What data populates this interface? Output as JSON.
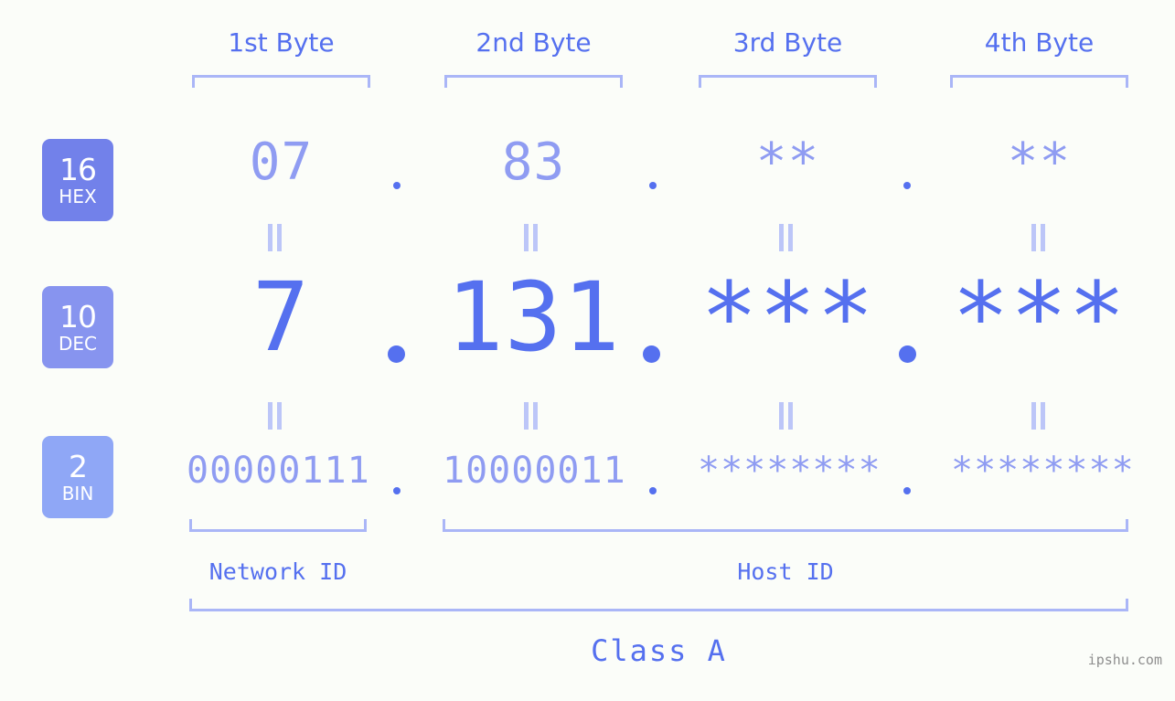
{
  "background_color": "#fbfdf9",
  "accent_color": "#5570ef",
  "muted_accent_color": "#8f9cf2",
  "bracket_color": "#aab6f7",
  "byte_headers": [
    {
      "label": "1st Byte"
    },
    {
      "label": "2nd Byte"
    },
    {
      "label": "3rd Byte"
    },
    {
      "label": "4th Byte"
    }
  ],
  "rows": [
    {
      "badge_number": "16",
      "badge_name": "HEX",
      "badge_color": "#7281ea",
      "values": [
        "07",
        "83",
        "**",
        "**"
      ],
      "separator": "."
    },
    {
      "badge_number": "10",
      "badge_name": "DEC",
      "badge_color": "#8794ef",
      "values": [
        "7",
        "131",
        "***",
        "***"
      ],
      "separator": "."
    },
    {
      "badge_number": "2",
      "badge_name": "BIN",
      "badge_color": "#8fa7f6",
      "values": [
        "00000111",
        "10000011",
        "********",
        "********"
      ],
      "separator": "."
    }
  ],
  "sections": [
    {
      "label": "Network ID"
    },
    {
      "label": "Host ID"
    }
  ],
  "class_label": "Class A",
  "watermark": "ipshu.com"
}
